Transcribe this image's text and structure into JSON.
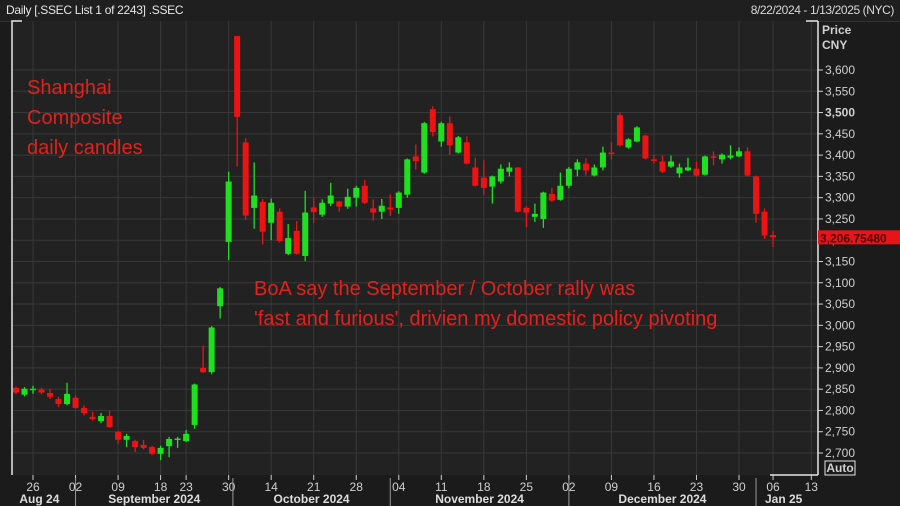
{
  "header": {
    "title": "Daily [.SSEC List 1 of 2243] .SSEC",
    "date_range": "8/22/2024 - 1/13/2025 (NYC)"
  },
  "axis": {
    "price_label": "Price",
    "currency_label": "CNY",
    "auto_button": "Auto",
    "last_price": "3,206.75480"
  },
  "annotations": {
    "label_lines": [
      "Shanghai",
      "Composite",
      "daily candles"
    ],
    "comment_lines": [
      "BoA say the September / October rally was",
      "'fast and furious', drivien my domestic policy pivoting"
    ]
  },
  "colors": {
    "up": "#1fe01f",
    "down": "#ee1212",
    "annotation": "#e3211c",
    "last_price_bg": "#e8141a"
  },
  "chart_data": {
    "type": "candlestick",
    "title": "Daily [.SSEC List 1 of 2243] .SSEC",
    "ylabel": "Price CNY",
    "ylim": [
      2700,
      3600
    ],
    "yticks": [
      "2,700",
      "2,750",
      "2,800",
      "2,850",
      "2,900",
      "2,950",
      "3,000",
      "3,050",
      "3,100",
      "3,150",
      "3,200",
      "3,250",
      "3,300",
      "3,350",
      "3,400",
      "3,450",
      "3,500",
      "3,550",
      "3,600"
    ],
    "ytick_values": [
      2700,
      2750,
      2800,
      2850,
      2900,
      2950,
      3000,
      3050,
      3100,
      3150,
      3200,
      3250,
      3300,
      3350,
      3400,
      3450,
      3500,
      3550,
      3600
    ],
    "grid": true,
    "xticks": [
      {
        "label": "26",
        "index": 2
      },
      {
        "label": "02",
        "index": 7
      },
      {
        "label": "09",
        "index": 12
      },
      {
        "label": "18",
        "index": 17
      },
      {
        "label": "23",
        "index": 20
      },
      {
        "label": "30",
        "index": 25
      },
      {
        "label": "14",
        "index": 30
      },
      {
        "label": "21",
        "index": 35
      },
      {
        "label": "28",
        "index": 40
      },
      {
        "label": "04",
        "index": 45
      },
      {
        "label": "11",
        "index": 50
      },
      {
        "label": "18",
        "index": 55
      },
      {
        "label": "25",
        "index": 60
      },
      {
        "label": "02",
        "index": 65
      },
      {
        "label": "09",
        "index": 70
      },
      {
        "label": "16",
        "index": 75
      },
      {
        "label": "23",
        "index": 80
      },
      {
        "label": "30",
        "index": 85
      },
      {
        "label": "06",
        "index": 89
      },
      {
        "label": "13",
        "index": 93.5
      }
    ],
    "months": [
      {
        "label": "Aug 24",
        "start": -1.5,
        "end": 7
      },
      {
        "label": "September 2024",
        "start": 7,
        "end": 25.5
      },
      {
        "label": "October 2024",
        "start": 25.5,
        "end": 44
      },
      {
        "label": "November 2024",
        "start": 44,
        "end": 65
      },
      {
        "label": "December 2024",
        "start": 65,
        "end": 87
      },
      {
        "label": "Jan 25",
        "start": 87,
        "end": 93.5
      }
    ],
    "last_close": 3206.7548,
    "ohlc_fields": [
      "open",
      "high",
      "low",
      "close"
    ],
    "ohlc": [
      [
        2853,
        2856,
        2838,
        2842
      ],
      [
        2837,
        2855,
        2833,
        2851
      ],
      [
        2849,
        2858,
        2839,
        2851
      ],
      [
        2849,
        2853,
        2838,
        2842
      ],
      [
        2841,
        2851,
        2827,
        2832
      ],
      [
        2827,
        2832,
        2808,
        2815
      ],
      [
        2815,
        2865,
        2812,
        2839
      ],
      [
        2830,
        2836,
        2804,
        2806
      ],
      [
        2806,
        2812,
        2788,
        2794
      ],
      [
        2785,
        2797,
        2776,
        2780
      ],
      [
        2775,
        2794,
        2770,
        2787
      ],
      [
        2787,
        2799,
        2759,
        2761
      ],
      [
        2750,
        2752,
        2721,
        2731
      ],
      [
        2731,
        2745,
        2714,
        2740
      ],
      [
        2728,
        2731,
        2702,
        2714
      ],
      [
        2719,
        2731,
        2709,
        2712
      ],
      [
        2714,
        2717,
        2695,
        2698
      ],
      [
        2698,
        2717,
        2683,
        2712
      ],
      [
        2716,
        2738,
        2690,
        2733
      ],
      [
        2731,
        2738,
        2712,
        2734
      ],
      [
        2728,
        2754,
        2726,
        2745
      ],
      [
        2766,
        2863,
        2757,
        2861
      ],
      [
        2900,
        2952,
        2888,
        2890
      ],
      [
        2890,
        2998,
        2885,
        2995
      ],
      [
        3045,
        3090,
        3016,
        3087
      ],
      [
        3196,
        3361,
        3153,
        3338
      ],
      [
        3680,
        3680,
        3373,
        3490
      ],
      [
        3430,
        3440,
        3248,
        3258
      ],
      [
        3276,
        3383,
        3227,
        3305
      ],
      [
        3290,
        3297,
        3190,
        3220
      ],
      [
        3241,
        3298,
        3200,
        3288
      ],
      [
        3267,
        3275,
        3195,
        3198
      ],
      [
        3168,
        3238,
        3165,
        3205
      ],
      [
        3222,
        3245,
        3166,
        3168
      ],
      [
        3163,
        3316,
        3151,
        3265
      ],
      [
        3277,
        3300,
        3241,
        3266
      ],
      [
        3260,
        3296,
        3255,
        3288
      ],
      [
        3286,
        3335,
        3280,
        3305
      ],
      [
        3291,
        3293,
        3267,
        3279
      ],
      [
        3279,
        3321,
        3274,
        3302
      ],
      [
        3300,
        3328,
        3279,
        3323
      ],
      [
        3328,
        3342,
        3285,
        3288
      ],
      [
        3275,
        3296,
        3246,
        3265
      ],
      [
        3267,
        3297,
        3250,
        3281
      ],
      [
        3277,
        3308,
        3257,
        3272
      ],
      [
        3276,
        3315,
        3262,
        3312
      ],
      [
        3307,
        3392,
        3300,
        3390
      ],
      [
        3397,
        3425,
        3366,
        3386
      ],
      [
        3359,
        3478,
        3356,
        3475
      ],
      [
        3508,
        3515,
        3444,
        3454
      ],
      [
        3432,
        3478,
        3420,
        3475
      ],
      [
        3475,
        3491,
        3401,
        3423
      ],
      [
        3406,
        3445,
        3404,
        3442
      ],
      [
        3430,
        3444,
        3378,
        3380
      ],
      [
        3371,
        3394,
        3326,
        3328
      ],
      [
        3347,
        3388,
        3307,
        3323
      ],
      [
        3326,
        3352,
        3286,
        3350
      ],
      [
        3338,
        3378,
        3333,
        3368
      ],
      [
        3361,
        3383,
        3350,
        3371
      ],
      [
        3371,
        3372,
        3265,
        3267
      ],
      [
        3276,
        3280,
        3231,
        3265
      ],
      [
        3255,
        3286,
        3243,
        3262
      ],
      [
        3250,
        3314,
        3229,
        3312
      ],
      [
        3309,
        3323,
        3290,
        3293
      ],
      [
        3295,
        3359,
        3293,
        3328
      ],
      [
        3328,
        3372,
        3322,
        3368
      ],
      [
        3366,
        3390,
        3350,
        3383
      ],
      [
        3380,
        3392,
        3352,
        3364
      ],
      [
        3352,
        3378,
        3350,
        3371
      ],
      [
        3371,
        3420,
        3364,
        3406
      ],
      [
        3406,
        3430,
        3390,
        3403
      ],
      [
        3494,
        3501,
        3420,
        3423
      ],
      [
        3418,
        3440,
        3415,
        3437
      ],
      [
        3432,
        3468,
        3430,
        3465
      ],
      [
        3446,
        3447,
        3390,
        3392
      ],
      [
        3390,
        3401,
        3380,
        3387
      ],
      [
        3385,
        3399,
        3358,
        3361
      ],
      [
        3373,
        3399,
        3370,
        3385
      ],
      [
        3357,
        3380,
        3347,
        3371
      ],
      [
        3364,
        3394,
        3362,
        3371
      ],
      [
        3368,
        3385,
        3350,
        3352
      ],
      [
        3354,
        3399,
        3352,
        3397
      ],
      [
        3397,
        3409,
        3376,
        3395
      ],
      [
        3390,
        3404,
        3380,
        3401
      ],
      [
        3394,
        3423,
        3390,
        3399
      ],
      [
        3397,
        3418,
        3395,
        3409
      ],
      [
        3409,
        3418,
        3350,
        3352
      ],
      [
        3350,
        3352,
        3241,
        3262
      ],
      [
        3267,
        3275,
        3203,
        3211
      ],
      [
        3212,
        3222,
        3184,
        3207
      ]
    ]
  }
}
